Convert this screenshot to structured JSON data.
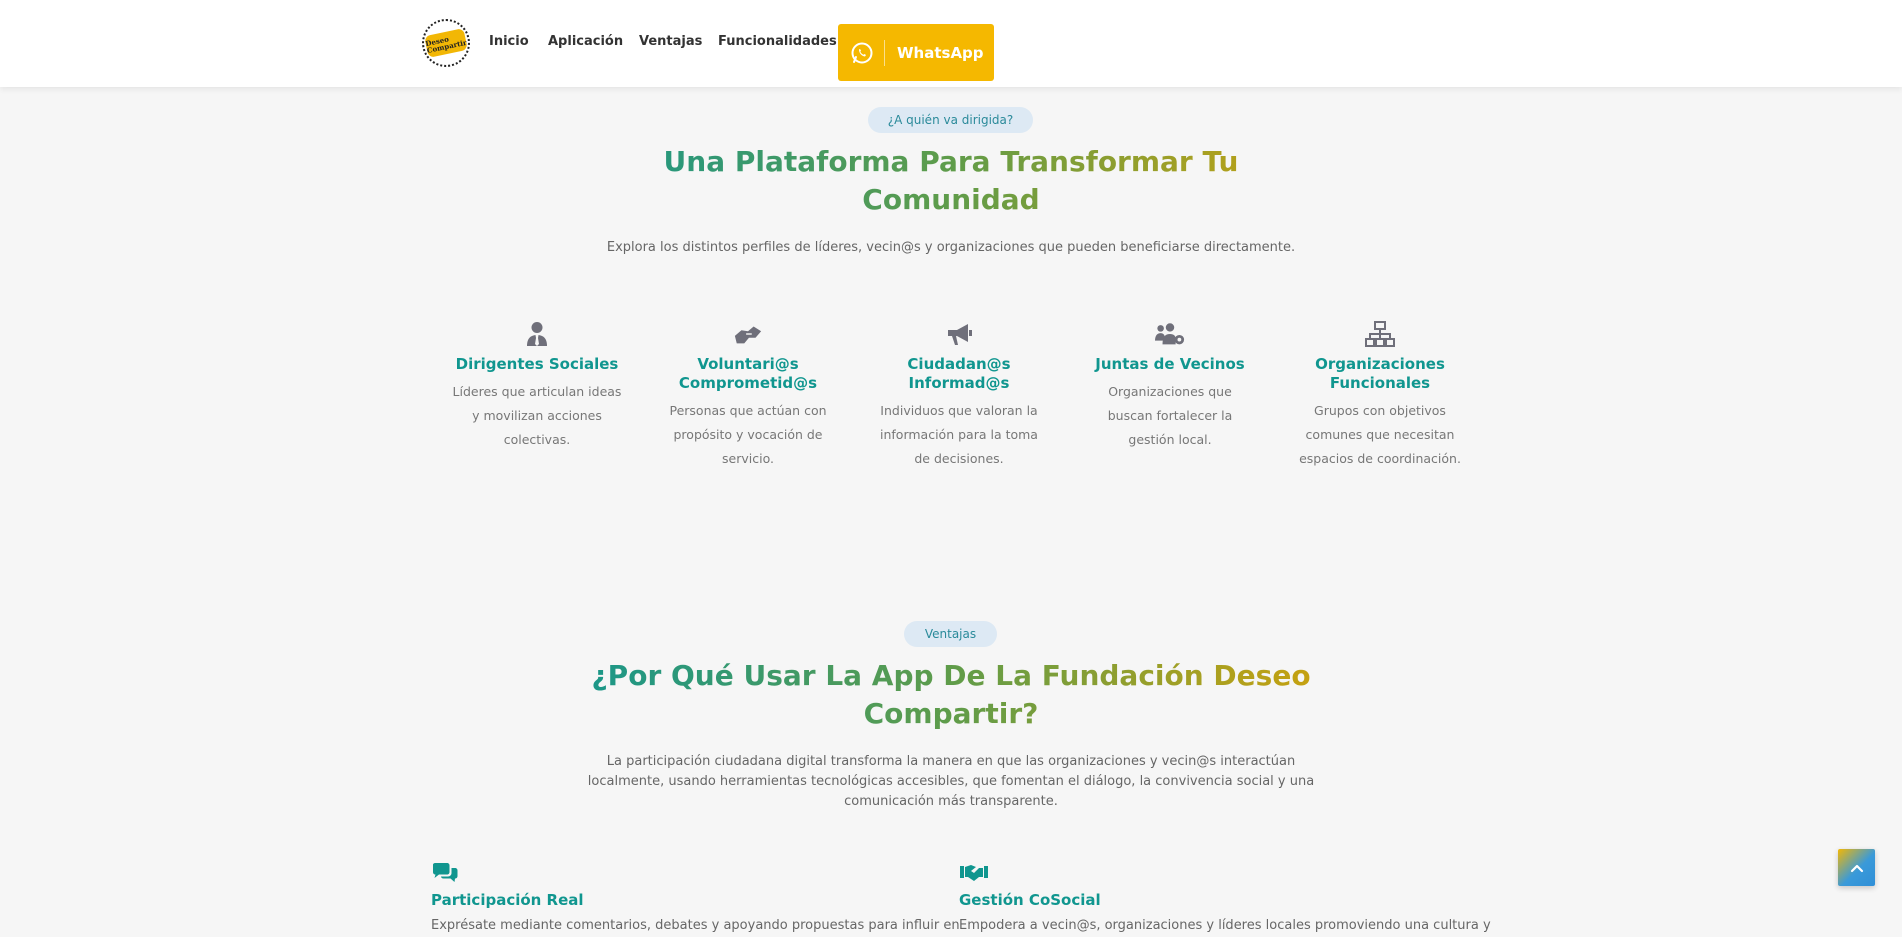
{
  "header": {
    "logo_text": "Deseo Compartir",
    "nav": [
      {
        "label": "Inicio"
      },
      {
        "label": "Aplicación"
      },
      {
        "label": "Ventajas"
      },
      {
        "label": "Funcionalidades"
      }
    ],
    "whatsapp_label": "WhatsApp"
  },
  "audience": {
    "badge": "¿A quién va dirigida?",
    "title_line1": "Una Plataforma Para Transformar Tu",
    "title_line2": "Comunidad",
    "subtitle": "Explora los distintos perfiles de líderes, vecin@s y organizaciones que pueden beneficiarse directamente.",
    "cards": [
      {
        "icon": "user-tie-icon",
        "title": "Dirigentes Sociales",
        "desc": "Líderes que articulan ideas y movilizan acciones colectivas."
      },
      {
        "icon": "hands-helping-icon",
        "title": "Voluntari@s Comprometid@s",
        "desc": "Personas que actúan con propósito y vocación de servicio."
      },
      {
        "icon": "bullhorn-icon",
        "title": "Ciudadan@s Informad@s",
        "desc": "Individuos que valoran la información para la toma de decisiones."
      },
      {
        "icon": "users-cog-icon",
        "title": "Juntas de Vecinos",
        "desc": "Organizaciones que buscan fortalecer la gestión local."
      },
      {
        "icon": "sitemap-icon",
        "title": "Organizaciones Funcionales",
        "desc": "Grupos con objetivos comunes que necesitan espacios de coordinación."
      }
    ]
  },
  "advantages": {
    "badge": "Ventajas",
    "title_line1": "¿Por Qué Usar La App De La Fundación Deseo",
    "title_line2": "Compartir?",
    "subtitle_line1": "La participación ciudadana digital transforma la manera en que las organizaciones y vecin@s interactúan",
    "subtitle_line2": "localmente, usando herramientas tecnológicas accesibles, que fomentan el diálogo, la convivencia social y una",
    "subtitle_line3": "comunicación más transparente.",
    "items": [
      {
        "icon": "comments-icon",
        "title": "Participación Real",
        "desc": "Exprésate mediante comentarios, debates y apoyando propuestas para influir en"
      },
      {
        "icon": "handshake-icon",
        "title": "Gestión CoSocial",
        "desc": "Empodera a vecin@s, organizaciones y líderes locales promoviendo una cultura y"
      }
    ]
  },
  "colors": {
    "accent_teal": "#10968f",
    "accent_gold": "#f5b800",
    "badge_bg": "#dde9f4"
  }
}
